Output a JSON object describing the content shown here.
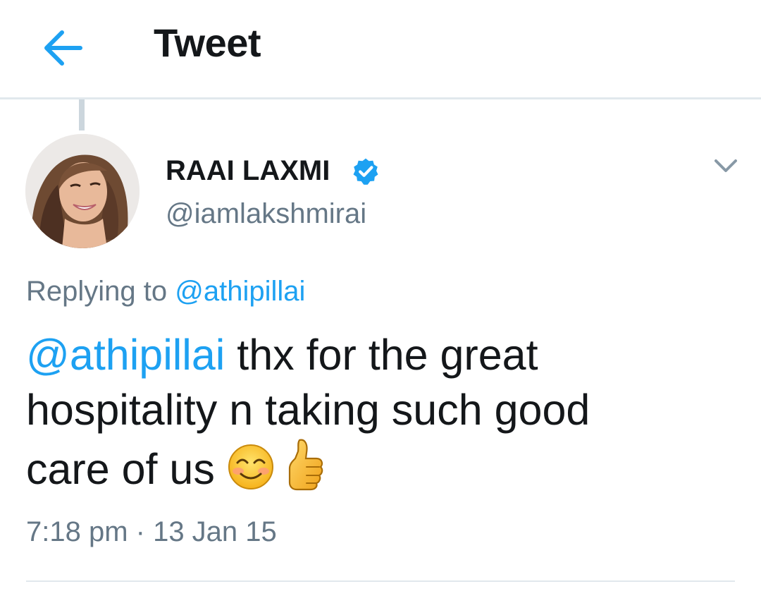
{
  "header": {
    "title": "Tweet",
    "back_icon": "arrow-left-icon",
    "accent_color": "#1da1f2"
  },
  "tweet": {
    "author": {
      "display_name": "RAAI LAXMI",
      "handle": "@iamlakshmirai",
      "verified_icon": "verified-badge-icon",
      "avatar_icon": "avatar-photo"
    },
    "menu_icon": "chevron-down-icon",
    "replying_to": {
      "prefix": "Replying to",
      "mention": "@athipillai"
    },
    "text": {
      "mention": "@athipillai",
      "line1_rest": " thx for the great",
      "line2": "hospitality n taking such good",
      "line3": "care of us "
    },
    "emojis": [
      "smiling-face-icon",
      "thumbs-up-icon"
    ],
    "time": "7:18 pm",
    "separator": " · ",
    "date": "13 Jan 15"
  },
  "colors": {
    "text_primary": "#14171a",
    "text_secondary": "#657786",
    "link": "#1da1f2",
    "divider": "#e1e8ed"
  }
}
